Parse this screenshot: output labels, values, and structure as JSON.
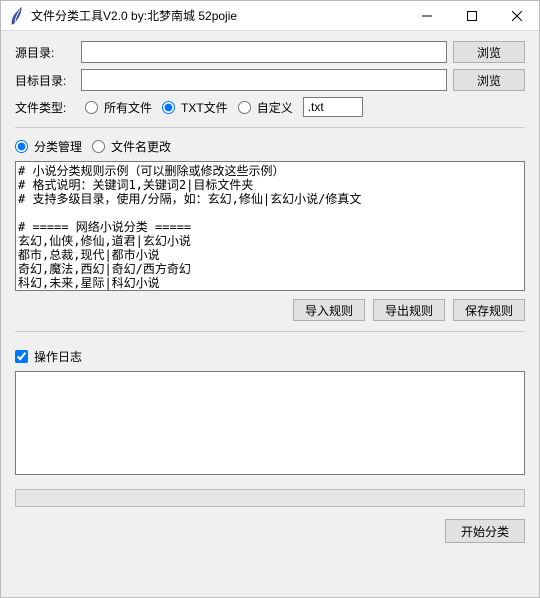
{
  "window": {
    "title": "文件分类工具V2.0   by:北梦南城  52pojie"
  },
  "labels": {
    "source_dir": "源目录:",
    "target_dir": "目标目录:",
    "file_type": "文件类型:"
  },
  "buttons": {
    "browse": "浏览",
    "import_rules": "导入规则",
    "export_rules": "导出规则",
    "save_rules": "保存规则",
    "start": "开始分类"
  },
  "inputs": {
    "source_dir": "",
    "target_dir": "",
    "ext": ".txt"
  },
  "file_type_radios": {
    "all": "所有文件",
    "txt": "TXT文件",
    "custom": "自定义"
  },
  "mode_radios": {
    "classify": "分类管理",
    "rename": "文件名更改"
  },
  "rules_text": "# 小说分类规则示例（可以删除或修改这些示例）\n# 格式说明：关键词1,关键词2|目标文件夹\n# 支持多级目录，使用/分隔，如：玄幻,修仙|玄幻小说/修真文\n\n# ===== 网络小说分类 =====\n玄幻,仙侠,修仙,道君|玄幻小说\n都市,总裁,现代|都市小说\n奇幻,魔法,西幻|奇幻/西方奇幻\n科幻,未来,星际|科幻小说\n历史,穿越|历史小说",
  "log_checkbox_label": "操作日志",
  "log_text": ""
}
